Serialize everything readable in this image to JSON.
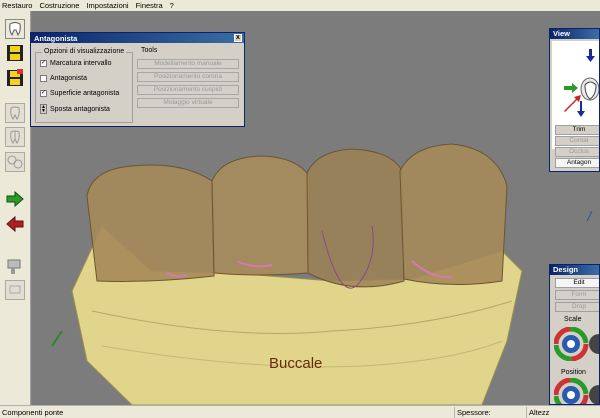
{
  "menu": [
    "Restauro",
    "Costruzione",
    "Impostazioni",
    "Finestra",
    "?"
  ],
  "toolbar_icons": [
    "tooth-icon",
    "save-icon",
    "save-as-icon",
    "crown-outline-icon",
    "crown-split-icon",
    "crown-group-icon",
    "forward-arrow-icon",
    "back-arrow-icon",
    "tool-icon",
    "tool-disabled-icon"
  ],
  "dialog": {
    "title": "Antagonista",
    "close": "x",
    "options_group": "Opzioni di visualizzazione",
    "options": [
      {
        "label": "Marcatura intervallo",
        "checked": true
      },
      {
        "label": "Antagonista",
        "checked": false
      },
      {
        "label": "Superficie antagonista",
        "checked": true
      }
    ],
    "move_label": "Sposta antagonista",
    "tools_group": "Tools",
    "tools": [
      "Modellamento manuale",
      "Posizionamento corona",
      "Posizionamento cuspidi",
      "Molaggio virtuale"
    ]
  },
  "view_panel": {
    "title": "View",
    "plus": "+",
    "buttons": [
      "Trim",
      "Contat",
      "Occlus",
      "Antagon"
    ]
  },
  "design_panel": {
    "title": "Design",
    "buttons": [
      "Edit",
      "Form",
      "Drop"
    ],
    "scale_label": "Scale",
    "position_label": "Position"
  },
  "viewport": {
    "side_label": "Buccale",
    "colors": {
      "tooth": "#a68a5a",
      "gum": "#e0d58a",
      "background": "#7c7c7c"
    }
  },
  "status": {
    "left": "Componenti ponte",
    "spessore": "Spessore:",
    "altezza": "Altezz"
  }
}
